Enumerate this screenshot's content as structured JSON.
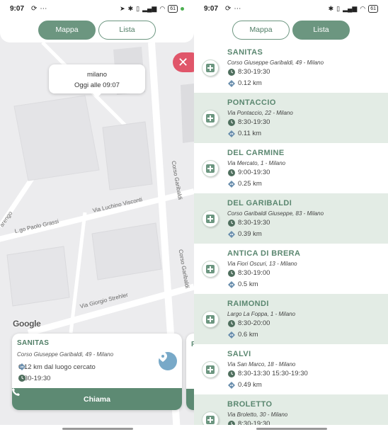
{
  "status": {
    "time": "9:07",
    "battery": "61"
  },
  "tabs": {
    "map": "Mappa",
    "list": "Lista"
  },
  "map": {
    "callout": {
      "city": "milano",
      "updated": "Oggi alle 09:07"
    },
    "streets": [
      "Corso Garibaldi",
      "Via Luchino Visconti",
      "L.go Paolo Grassi",
      "Corso Garibaldi",
      "Via Giorgio Strehler",
      "arengo"
    ],
    "google": "Google",
    "close_glyph": "✕",
    "card": {
      "name": "SANITAS",
      "address": "Corso Giuseppe Garibaldi, 49 - Milano",
      "distance": "0.12 km dal luogo cercato",
      "hours": "8:30-19:30",
      "call": "Chiama"
    },
    "peek_letter": "F"
  },
  "list": [
    {
      "name": "SANITAS",
      "address": "Corso Giuseppe Garibaldi, 49 - Milano",
      "hours": "8:30-19:30",
      "distance": "0.12 km"
    },
    {
      "name": "PONTACCIO",
      "address": "Via Pontaccio, 22 - Milano",
      "hours": "8:30-19:30",
      "distance": "0.11 km"
    },
    {
      "name": "DEL CARMINE",
      "address": "Via Mercato, 1 - Milano",
      "hours": "9:00-19:30",
      "distance": "0.25 km"
    },
    {
      "name": "DEL GARIBALDI",
      "address": "Corso Garibaldi Giuseppe, 83 - Milano",
      "hours": "8:30-19:30",
      "distance": "0.39 km"
    },
    {
      "name": "ANTICA DI BRERA",
      "address": "Via Fiori Oscuri, 13 - Milano",
      "hours": "8:30-19:00",
      "distance": "0.5 km"
    },
    {
      "name": "RAIMONDI",
      "address": "Largo La Foppa, 1 - Milano",
      "hours": "8:30-20:00",
      "distance": "0.6 km"
    },
    {
      "name": "SALVI",
      "address": "Via San Marco, 18 - Milano",
      "hours": "8:30-13:30 15:30-19:30",
      "distance": "0.49 km"
    },
    {
      "name": "BROLETTO",
      "address": "Via Broletto, 30 - Milano",
      "hours": "8:30-19:30",
      "distance": ""
    }
  ],
  "colors": {
    "accent": "#6c9680",
    "close": "#e0566a",
    "alt_row": "#e3ece5"
  }
}
